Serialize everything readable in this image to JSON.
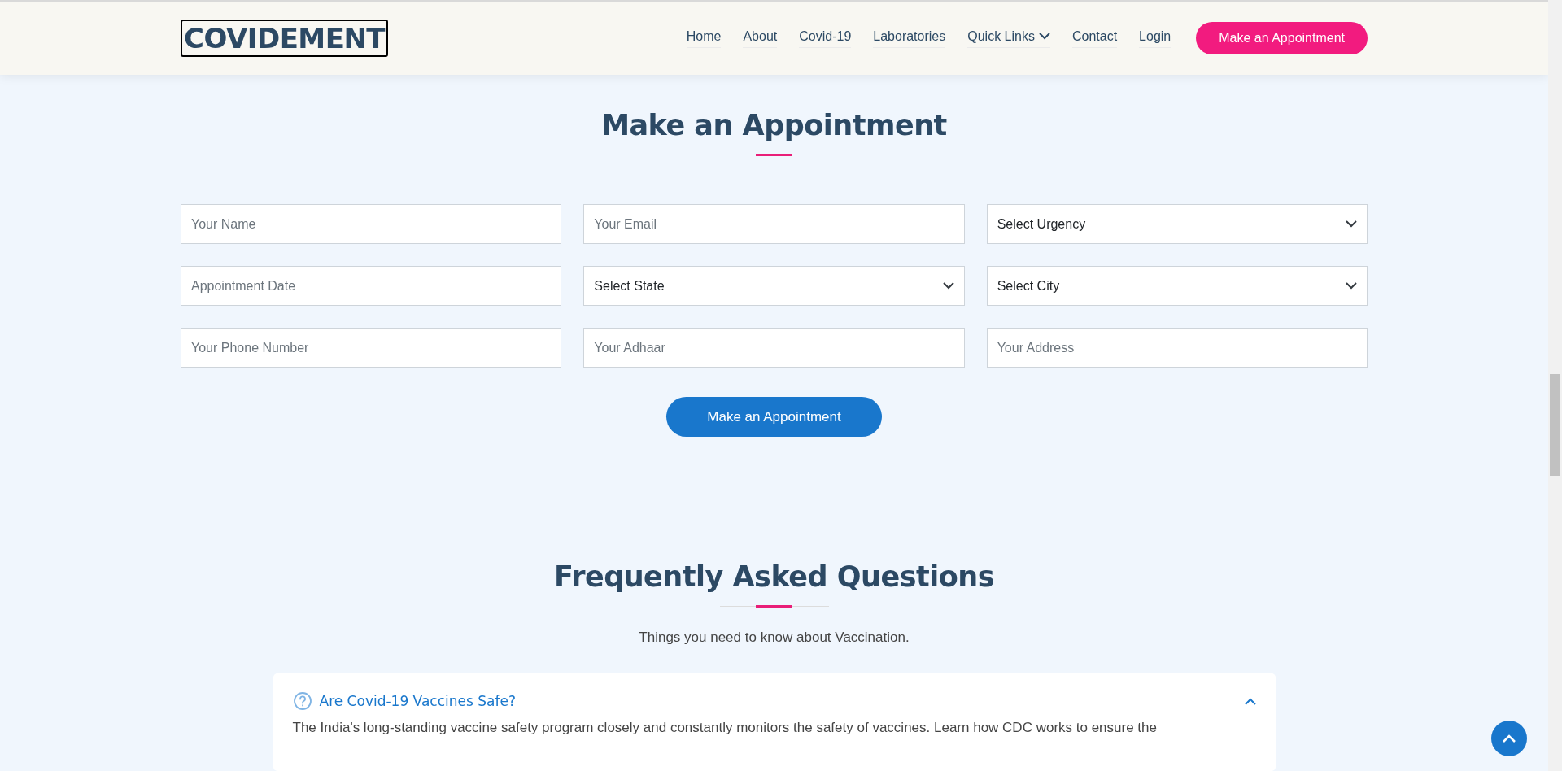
{
  "header": {
    "logo": "COVIDEMENT",
    "nav": [
      {
        "label": "Home",
        "dropdown": false
      },
      {
        "label": "About",
        "dropdown": false
      },
      {
        "label": "Covid-19",
        "dropdown": false
      },
      {
        "label": "Laboratories",
        "dropdown": false
      },
      {
        "label": "Quick Links",
        "dropdown": true
      },
      {
        "label": "Contact",
        "dropdown": false
      },
      {
        "label": "Login",
        "dropdown": false
      }
    ],
    "cta": "Make an Appointment"
  },
  "appointment": {
    "title": "Make an Appointment",
    "fields": [
      {
        "kind": "input",
        "placeholder": "Your Name"
      },
      {
        "kind": "input",
        "placeholder": "Your Email"
      },
      {
        "kind": "select",
        "value": "Select Urgency"
      },
      {
        "kind": "input",
        "placeholder": "Appointment Date"
      },
      {
        "kind": "select",
        "value": "Select State"
      },
      {
        "kind": "select",
        "value": "Select City"
      },
      {
        "kind": "input",
        "placeholder": "Your Phone Number"
      },
      {
        "kind": "input",
        "placeholder": "Your Adhaar"
      },
      {
        "kind": "input",
        "placeholder": "Your Address"
      }
    ],
    "submit": "Make an Appointment"
  },
  "faq": {
    "title": "Frequently Asked Questions",
    "subtitle": "Things you need to know about Vaccination.",
    "items": [
      {
        "question": "Are Covid-19 Vaccines Safe?",
        "expanded": true,
        "answer": "The India's long-standing vaccine safety program closely and constantly monitors the safety of vaccines. Learn how CDC works to ensure the"
      }
    ]
  }
}
